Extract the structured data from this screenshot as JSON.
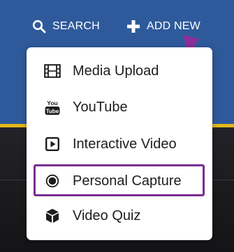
{
  "toolbar": {
    "search_label": "SEARCH",
    "add_new_label": "ADD NEW"
  },
  "menu": {
    "items": [
      {
        "label": "Media Upload",
        "icon": "film-icon"
      },
      {
        "label": "YouTube",
        "icon": "youtube-icon"
      },
      {
        "label": "Interactive Video",
        "icon": "play-square-icon"
      },
      {
        "label": "Personal Capture",
        "icon": "record-icon"
      },
      {
        "label": "Video Quiz",
        "icon": "cube-icon"
      }
    ]
  },
  "youtube_logo": {
    "top": "You",
    "bottom": "Tube"
  },
  "colors": {
    "header": "#2e5a9b",
    "accent_stripe": "#e3b71b",
    "highlight": "#7a2c92",
    "arrow": "#8b2f98"
  }
}
